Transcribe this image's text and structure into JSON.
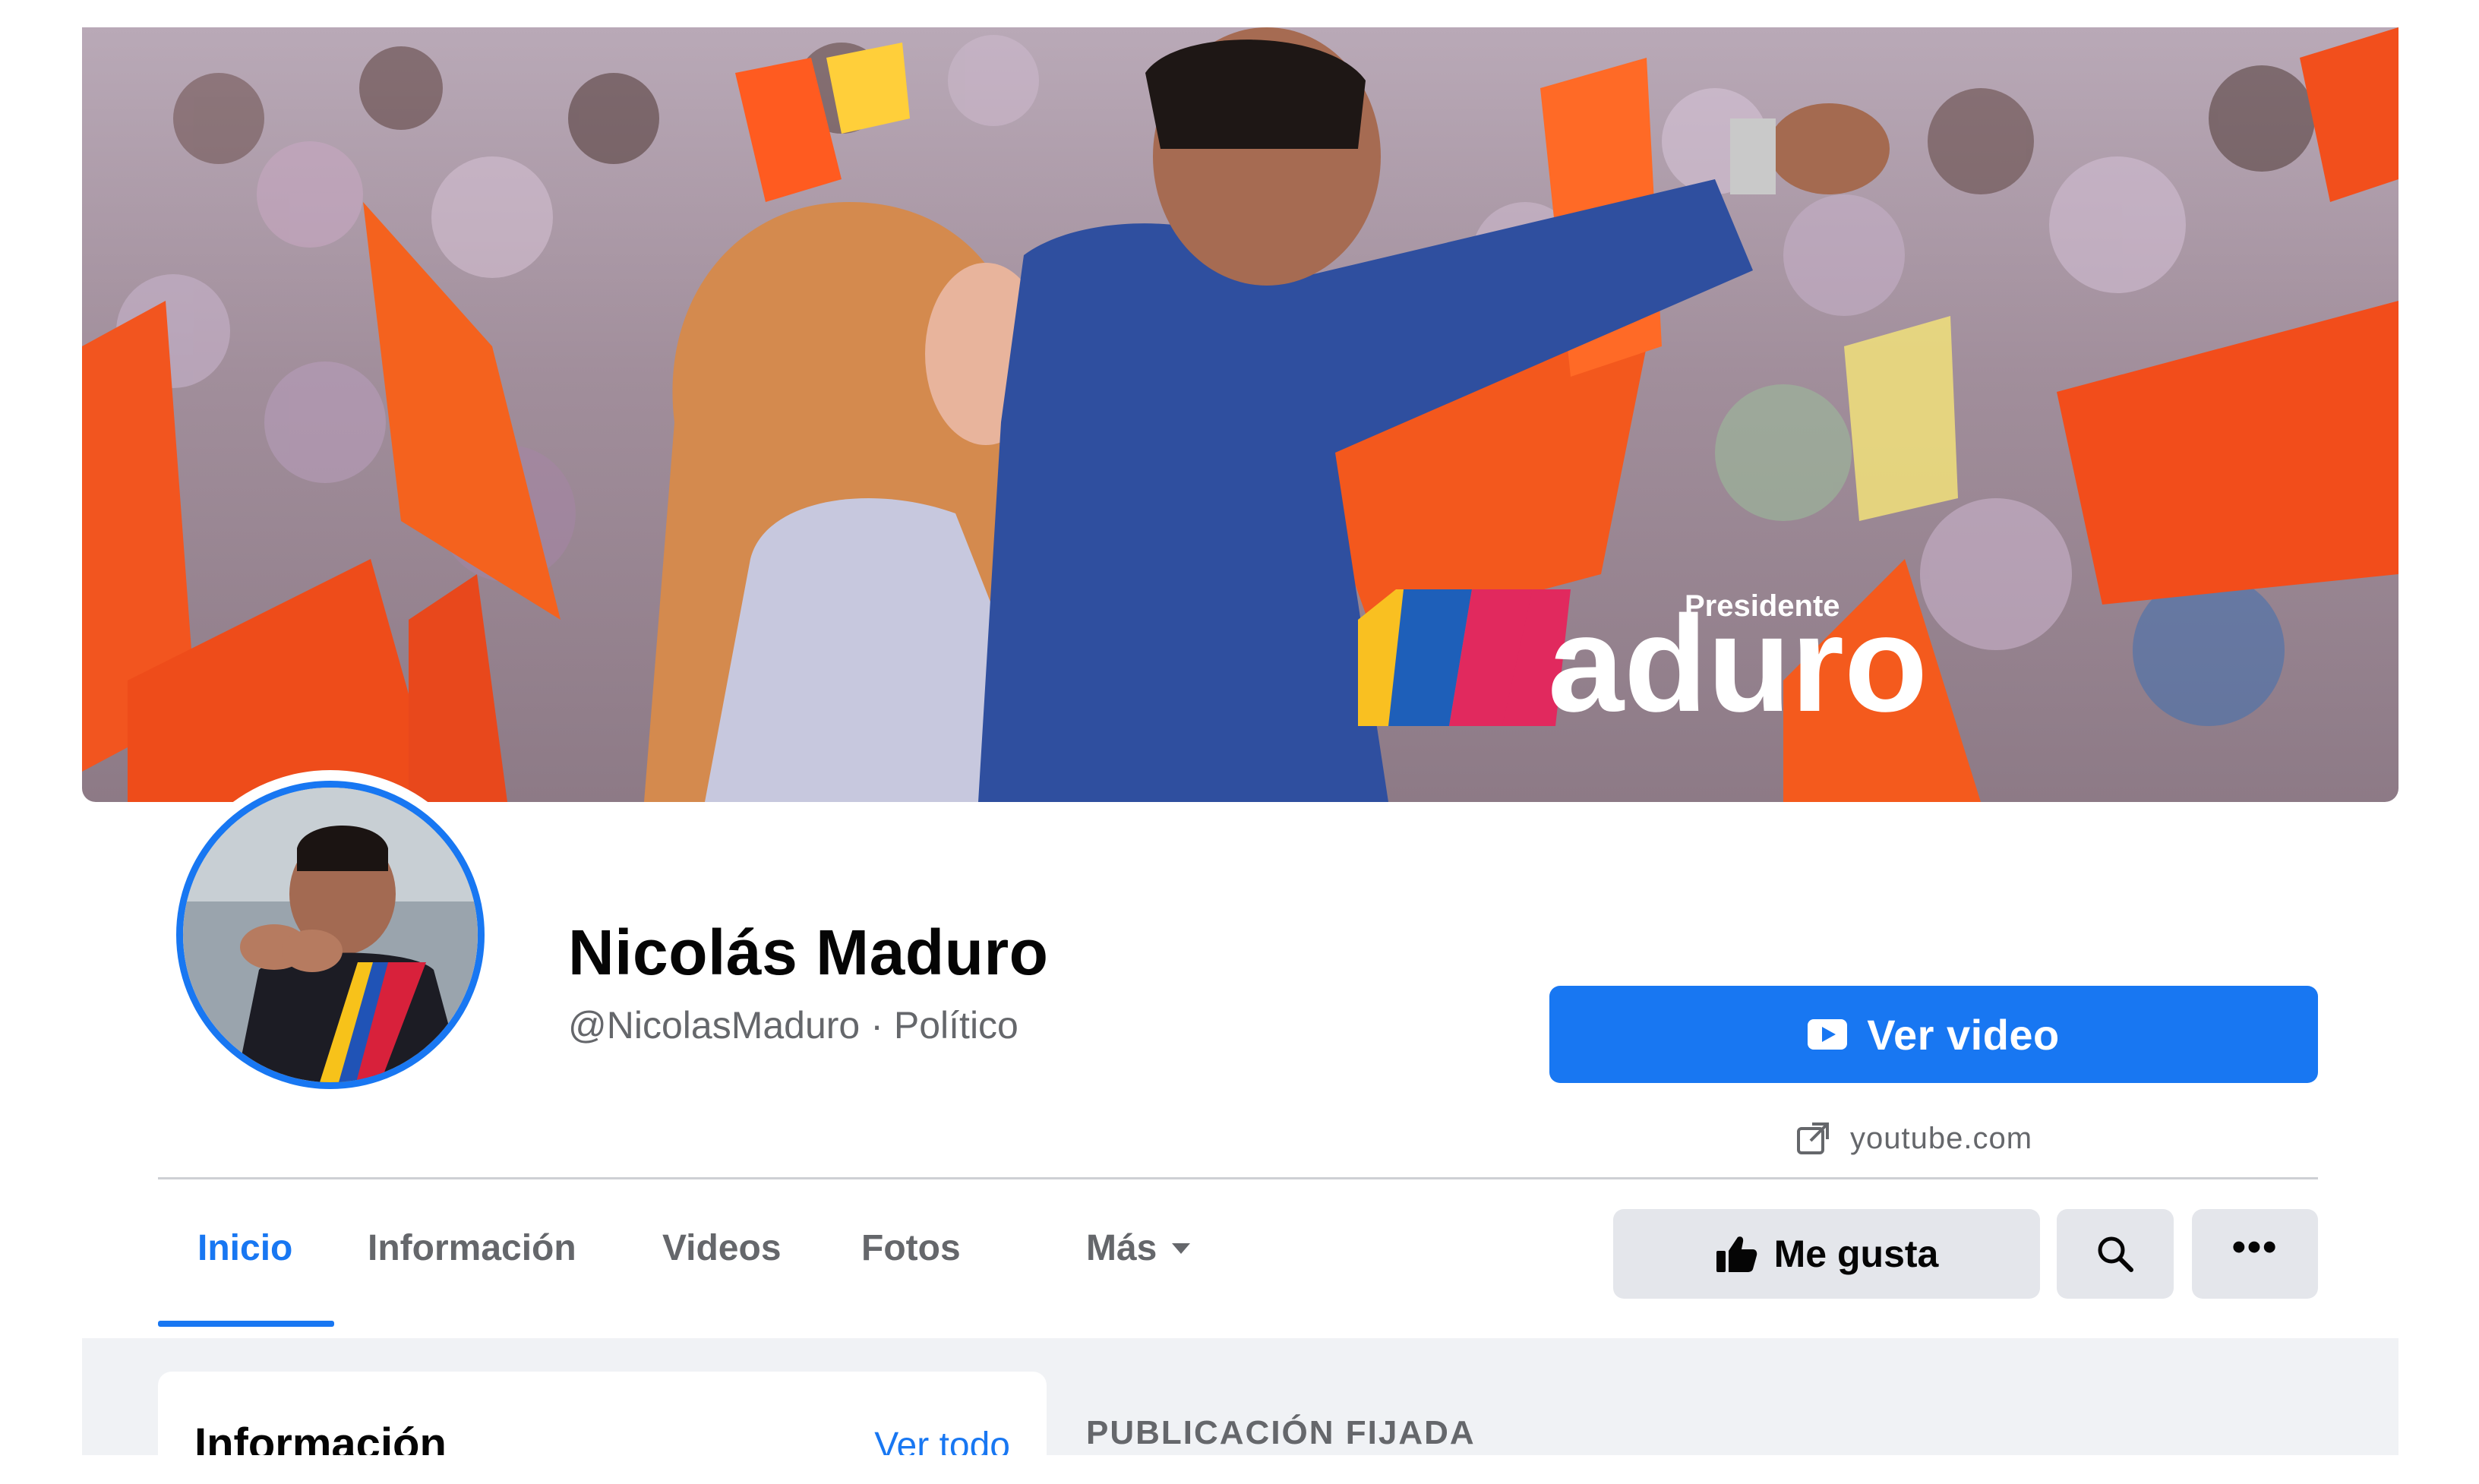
{
  "colors": {
    "accent": "#1877f2",
    "text_primary": "#050505",
    "text_secondary": "#65676b",
    "button_gray": "#e4e6eb",
    "feed_background": "#f0f2f5"
  },
  "cover": {
    "logo_text": "aduro",
    "logo_small": "Presidente"
  },
  "profile": {
    "name": "Nicolás Maduro",
    "handle": "@NicolasMaduro",
    "separator": "·",
    "category": "Político"
  },
  "cta": {
    "label": "Ver video",
    "icon": "play-video-icon",
    "link_icon": "external-link-icon",
    "link_text": "youtube.com"
  },
  "tabs": [
    {
      "label": "Inicio",
      "active": true
    },
    {
      "label": "Información",
      "active": false
    },
    {
      "label": "Videos",
      "active": false
    },
    {
      "label": "Fotos",
      "active": false
    },
    {
      "label": "Más",
      "active": false
    }
  ],
  "actions": {
    "like_label": "Me gusta",
    "like_icon": "thumbs-up-icon",
    "search_icon": "search-icon",
    "more_label": "•••"
  },
  "info_card": {
    "title": "Información",
    "see_all": "Ver todo"
  },
  "pinned": {
    "label": "PUBLICACIÓN FIJADA"
  }
}
